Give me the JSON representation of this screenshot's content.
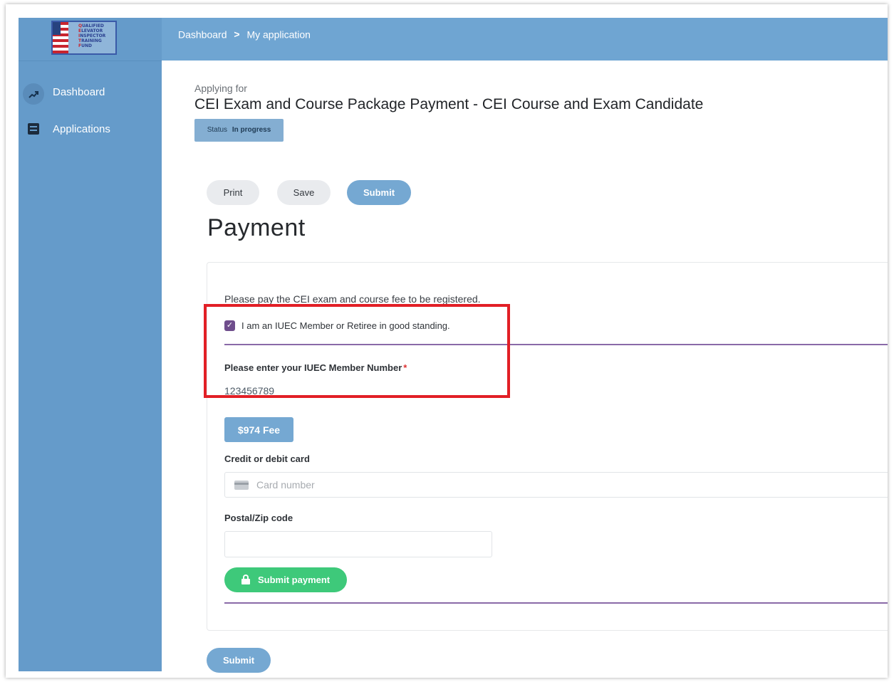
{
  "logo": {
    "lines": [
      "QUALIFIED",
      "ELEVATOR",
      "INSPECTOR",
      "TRAINING",
      "FUND"
    ]
  },
  "sidebar": {
    "items": [
      {
        "label": "Dashboard",
        "icon": "trending-up-icon"
      },
      {
        "label": "Applications",
        "icon": "document-icon"
      }
    ]
  },
  "breadcrumb": {
    "items": [
      "Dashboard",
      "My application"
    ],
    "separator": ">"
  },
  "application": {
    "applying_label": "Applying for",
    "title": "CEI Exam and Course Package Payment - CEI Course and Exam Candidate",
    "status_label": "Status",
    "status_value": "In progress"
  },
  "toolbar": {
    "print_label": "Print",
    "save_label": "Save",
    "submit_label": "Submit"
  },
  "form": {
    "heading": "Payment",
    "intro": "Please pay the CEI exam and course fee to be registered.",
    "member_checkbox_label": "I am an IUEC Member or Retiree in good standing.",
    "member_checkbox_checked": true,
    "member_number_label": "Please enter your IUEC Member Number",
    "required_marker": "*",
    "member_number_value": "123456789",
    "fee_label": "$974 Fee",
    "card_label": "Credit or debit card",
    "card_placeholder": "Card number",
    "zip_label": "Postal/Zip code",
    "zip_value": "",
    "submit_payment_label": "Submit payment"
  },
  "footer": {
    "submit_label": "Submit"
  },
  "colors": {
    "sidebar": "#659bca",
    "topbar": "#6fa5d2",
    "accent_blue": "#75a8d2",
    "checkbox_purple": "#6f4d8c",
    "divider_purple": "#8a6aa8",
    "success_green": "#3ec97a",
    "highlight_red": "#e21f26"
  }
}
